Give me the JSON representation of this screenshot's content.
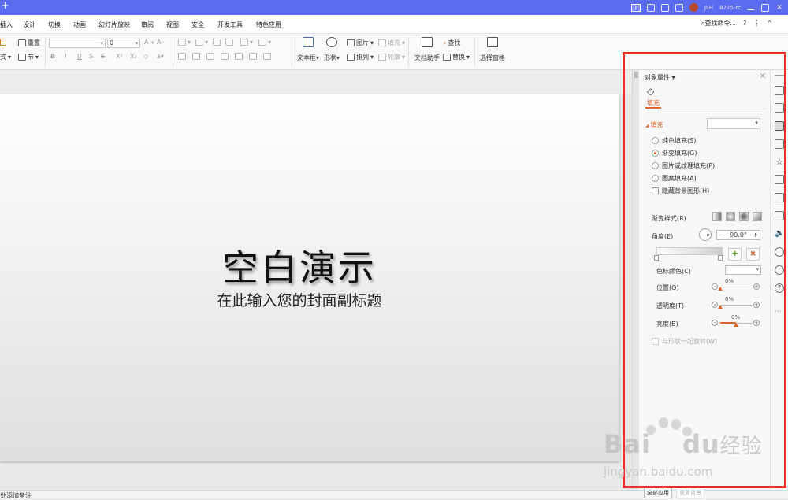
{
  "app": {
    "badge": "1",
    "user_name": "JLH",
    "user_id": "8775-rc"
  },
  "menu": {
    "tabs": [
      "插入",
      "设计",
      "切换",
      "动画",
      "幻灯片放映",
      "审阅",
      "视图",
      "安全",
      "开发工具",
      "特色应用"
    ],
    "search_label": "查找命令...",
    "help": "?",
    "more": "⋮",
    "collapse": "^"
  },
  "ribbon": {
    "reset": "重置",
    "layout_partial": "式",
    "section": "节",
    "font_size": "0",
    "textbox": "文本框",
    "shape": "形状",
    "picture": "图片",
    "arrange": "排列",
    "fill": "填充",
    "outline": "轮廓",
    "doc_assistant": "文档助手",
    "find": "查找",
    "replace": "替换",
    "selection_pane": "选择窗格"
  },
  "slide": {
    "title": "空白演示",
    "subtitle": "在此输入您的封面副标题"
  },
  "status": {
    "notes_hint": "处添加备注",
    "apply_all": "全部应用",
    "reset_bg": "重置背景"
  },
  "panel": {
    "title": "对象属性",
    "close": "×",
    "tab_fill": "填充",
    "section_fill": "填充",
    "options": [
      "纯色填充(S)",
      "渐变填充(G)",
      "图片或纹理填充(P)",
      "图案填充(A)"
    ],
    "selected_option": "渐变填充(G)",
    "hide_bg": "隐藏背景图形(H)",
    "gradient_style": "渐变样式(R)",
    "angle_label": "角度(E)",
    "angle_value": "90.0°",
    "minus": "−",
    "plus": "+",
    "stop_color": "色标颜色(C)",
    "position_label": "位置(O)",
    "position_value": "0%",
    "transparency_label": "透明度(T)",
    "transparency_value": "0%",
    "brightness_label": "亮度(B)",
    "brightness_value": "0%",
    "rotate_with_shape": "与形状一起旋转(W)"
  },
  "levels": {
    "position": 0.0,
    "transparency": 0.0,
    "brightness": 0.5
  },
  "colors": {
    "titlebar": "#5b6cf0",
    "accent": "#e0632a",
    "highlight_box": "#ee2b2b"
  },
  "icons": [
    "plus-icon",
    "search-icon",
    "close-icon",
    "gradient-style-icon",
    "add-stop-icon",
    "delete-stop-icon"
  ],
  "watermark": {
    "logo": "Bai",
    "logo_du": "du",
    "logo_jy": "经验",
    "url": "jingyan.baidu.com"
  }
}
